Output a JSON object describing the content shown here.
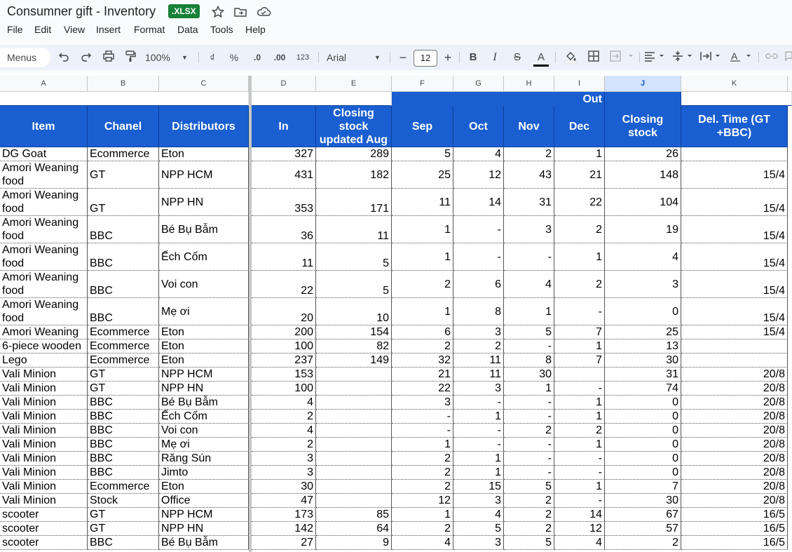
{
  "document": {
    "title": "Consumner gift - Inventory",
    "format_badge": ".XLSX"
  },
  "menu": [
    "File",
    "Edit",
    "View",
    "Insert",
    "Format",
    "Data",
    "Tools",
    "Help"
  ],
  "toolbar": {
    "menus_label": "Menus",
    "zoom": "100%",
    "currency_symbol": "₫",
    "percent_symbol": "%",
    "decrease_decimal": ".0",
    "increase_decimal": ".00",
    "number_format": "123",
    "font_family": "Arial",
    "font_size": "12",
    "minus": "−",
    "plus": "+",
    "bold": "B",
    "italic": "I",
    "strikethrough": "S",
    "text_color": "A"
  },
  "colors": {
    "header_blue": "#1a5fd1",
    "xlsx_green": "#188038",
    "selected_col": "#d3e3fd"
  },
  "columns": [
    "A",
    "B",
    "C",
    "D",
    "E",
    "F",
    "G",
    "H",
    "I",
    "J",
    "K"
  ],
  "selected_column": "J",
  "header": {
    "out_label": "Out",
    "item": "Item",
    "chanel": "Chanel",
    "distributors": "Distributors",
    "in": "In",
    "closing_aug": "Closing stock updated Aug",
    "sep": "Sep",
    "oct": "Oct",
    "nov": "Nov",
    "dec": "Dec",
    "closing": "Closing stock",
    "del_time": "Del. Time (GT +BBC)"
  },
  "rows": [
    {
      "item": "DG Goat",
      "chanel": "Ecommerce",
      "dist": "Eton",
      "in": "327",
      "aug": "289",
      "sep": "5",
      "oct": "4",
      "nov": "2",
      "dec": "1",
      "closing": "26",
      "del": ""
    },
    {
      "item": "Amori Weaning food",
      "chanel": "GT",
      "dist": "NPP HCM",
      "in": "431",
      "aug": "182",
      "sep": "25",
      "oct": "12",
      "nov": "43",
      "dec": "21",
      "closing": "148",
      "del": "15/4"
    },
    {
      "item": "Amori Weaning food",
      "chanel": "GT",
      "dist": "NPP HN",
      "in": "353",
      "aug": "171",
      "sep": "11",
      "oct": "14",
      "nov": "31",
      "dec": "22",
      "closing": "104",
      "del": "15/4"
    },
    {
      "item": "Amori Weaning food",
      "chanel": "BBC",
      "dist": "Bé Bụ Bẫm",
      "in": "36",
      "aug": "11",
      "sep": "1",
      "oct": "-",
      "nov": "3",
      "dec": "2",
      "closing": "19",
      "del": "15/4"
    },
    {
      "item": "Amori Weaning food",
      "chanel": "BBC",
      "dist": "Ếch Cốm",
      "in": "11",
      "aug": "5",
      "sep": "1",
      "oct": "-",
      "nov": "-",
      "dec": "1",
      "closing": "4",
      "del": "15/4"
    },
    {
      "item": "Amori Weaning food",
      "chanel": "BBC",
      "dist": "Voi con",
      "in": "22",
      "aug": "5",
      "sep": "2",
      "oct": "6",
      "nov": "4",
      "dec": "2",
      "closing": "3",
      "del": "15/4"
    },
    {
      "item": "Amori Weaning food",
      "chanel": "BBC",
      "dist": "Mẹ ơi",
      "in": "20",
      "aug": "10",
      "sep": "1",
      "oct": "8",
      "nov": "1",
      "dec": "-",
      "closing": "0",
      "del": "15/4"
    },
    {
      "item": "Amori Weaning",
      "chanel": "Ecommerce",
      "dist": "Eton",
      "in": "200",
      "aug": "154",
      "sep": "6",
      "oct": "3",
      "nov": "5",
      "dec": "7",
      "closing": "25",
      "del": "15/4"
    },
    {
      "item": "6-piece wooden",
      "chanel": "Ecommerce",
      "dist": "Eton",
      "in": "100",
      "aug": "82",
      "sep": "2",
      "oct": "2",
      "nov": "-",
      "dec": "1",
      "closing": "13",
      "del": ""
    },
    {
      "item": "Lego",
      "chanel": "Ecommerce",
      "dist": "Eton",
      "in": "237",
      "aug": "149",
      "sep": "32",
      "oct": "11",
      "nov": "8",
      "dec": "7",
      "closing": "30",
      "del": ""
    },
    {
      "item": "Vali Minion",
      "chanel": "GT",
      "dist": "NPP HCM",
      "in": "153",
      "aug": "",
      "sep": "21",
      "oct": "11",
      "nov": "30",
      "dec": "",
      "closing": "31",
      "del": "20/8"
    },
    {
      "item": "Vali Minion",
      "chanel": "GT",
      "dist": "NPP HN",
      "in": "100",
      "aug": "",
      "sep": "22",
      "oct": "3",
      "nov": "1",
      "dec": "-",
      "closing": "74",
      "del": "20/8"
    },
    {
      "item": "Vali Minion",
      "chanel": "BBC",
      "dist": "Bé Bụ Bẫm",
      "in": "4",
      "aug": "",
      "sep": "3",
      "oct": "-",
      "nov": "-",
      "dec": "1",
      "closing": "0",
      "del": "20/8"
    },
    {
      "item": "Vali Minion",
      "chanel": "BBC",
      "dist": "Ếch Cốm",
      "in": "2",
      "aug": "",
      "sep": "-",
      "oct": "1",
      "nov": "-",
      "dec": "1",
      "closing": "0",
      "del": "20/8"
    },
    {
      "item": "Vali Minion",
      "chanel": "BBC",
      "dist": "Voi con",
      "in": "4",
      "aug": "",
      "sep": "-",
      "oct": "-",
      "nov": "2",
      "dec": "2",
      "closing": "0",
      "del": "20/8"
    },
    {
      "item": "Vali Minion",
      "chanel": "BBC",
      "dist": "Mẹ ơi",
      "in": "2",
      "aug": "",
      "sep": "1",
      "oct": "-",
      "nov": "-",
      "dec": "1",
      "closing": "0",
      "del": "20/8"
    },
    {
      "item": "Vali Minion",
      "chanel": "BBC",
      "dist": "Răng Sún",
      "in": "3",
      "aug": "",
      "sep": "2",
      "oct": "1",
      "nov": "-",
      "dec": "-",
      "closing": "0",
      "del": "20/8"
    },
    {
      "item": "Vali Minion",
      "chanel": "BBC",
      "dist": "Jimto",
      "in": "3",
      "aug": "",
      "sep": "2",
      "oct": "1",
      "nov": "-",
      "dec": "-",
      "closing": "0",
      "del": "20/8"
    },
    {
      "item": "Vali Minion",
      "chanel": "Ecommerce",
      "dist": "Eton",
      "in": "30",
      "aug": "",
      "sep": "2",
      "oct": "15",
      "nov": "5",
      "dec": "1",
      "closing": "7",
      "del": "20/8"
    },
    {
      "item": "Vali Minion",
      "chanel": "Stock",
      "dist": "Office",
      "in": "47",
      "aug": "",
      "sep": "12",
      "oct": "3",
      "nov": "2",
      "dec": "-",
      "closing": "30",
      "del": "20/8"
    },
    {
      "item": "scooter",
      "chanel": "GT",
      "dist": "NPP HCM",
      "in": "173",
      "aug": "85",
      "sep": "1",
      "oct": "4",
      "nov": "2",
      "dec": "14",
      "closing": "67",
      "del": "16/5"
    },
    {
      "item": "scooter",
      "chanel": "GT",
      "dist": "NPP HN",
      "in": "142",
      "aug": "64",
      "sep": "2",
      "oct": "5",
      "nov": "2",
      "dec": "12",
      "closing": "57",
      "del": "16/5"
    },
    {
      "item": "scooter",
      "chanel": "BBC",
      "dist": "Bé Bụ Bẫm",
      "in": "27",
      "aug": "9",
      "sep": "4",
      "oct": "3",
      "nov": "5",
      "dec": "4",
      "closing": "2",
      "del": "16/5"
    }
  ]
}
